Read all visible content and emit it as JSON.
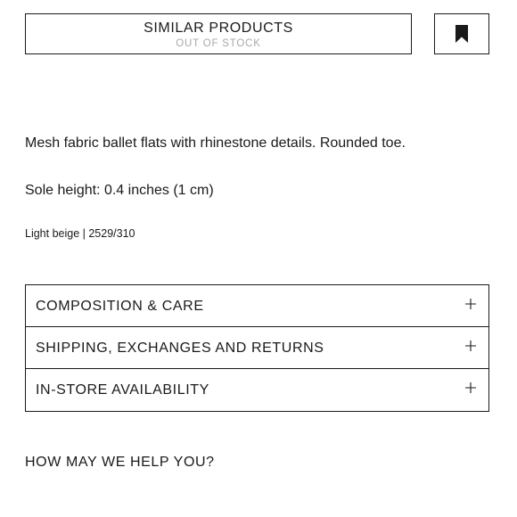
{
  "similar_products": {
    "label": "SIMILAR PRODUCTS",
    "status": "OUT OF STOCK"
  },
  "bookmark": {
    "icon": "bookmark-icon"
  },
  "product": {
    "description": "Mesh fabric ballet flats with rhinestone details. Rounded toe.",
    "sole_height": "Sole height: 0.4 inches (1 cm)",
    "color_reference": "Light beige | 2529/310"
  },
  "accordion": {
    "items": [
      {
        "label": "COMPOSITION & CARE",
        "icon": "plus-icon"
      },
      {
        "label": "SHIPPING, EXCHANGES AND RETURNS",
        "icon": "plus-icon"
      },
      {
        "label": "IN-STORE AVAILABILITY",
        "icon": "plus-icon"
      }
    ]
  },
  "help": {
    "label": "HOW MAY WE HELP YOU?"
  },
  "colors": {
    "text": "#1a1a1a",
    "muted": "#a8a8a8",
    "background": "#ffffff"
  }
}
